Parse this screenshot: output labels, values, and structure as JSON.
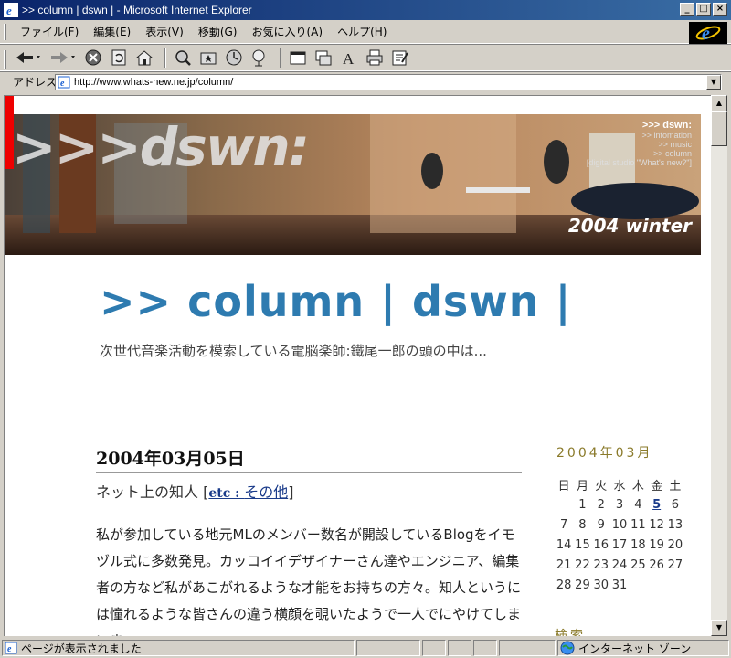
{
  "window": {
    "title": ">> column | dswn | - Microsoft Internet Explorer"
  },
  "menu": {
    "items": [
      "ファイル(F)",
      "編集(E)",
      "表示(V)",
      "移動(G)",
      "お気に入り(A)",
      "ヘルプ(H)"
    ]
  },
  "toolbar": {
    "buttons": [
      "back-icon",
      "forward-icon",
      "stop-icon",
      "refresh-icon",
      "home-icon",
      "search-icon",
      "favorites-icon",
      "history-icon",
      "channels-icon",
      "fullscreen-icon",
      "mail-icon",
      "font-icon",
      "print-icon",
      "edit-icon"
    ]
  },
  "address": {
    "label": "アドレス",
    "url": "http://www.whats-new.ne.jp/column/"
  },
  "banner": {
    "logo": ">>>dswn:",
    "nav_title": ">>> dswn:",
    "nav_items": [
      ">> infomation",
      ">> music",
      ">> column",
      "[digital studio \"What's new?\"]"
    ],
    "season": "2004 winter"
  },
  "page": {
    "title": ">> column | dswn |",
    "subtitle": "次世代音楽活動を模索している電脳楽師:鐵尾一郎の頭の中は..."
  },
  "entry": {
    "date": "2004年03月05日",
    "title": "ネット上の知人",
    "category_prefix": "etc : ",
    "category_name": "その他",
    "body": "私が参加している地元MLのメンバー数名が開設しているBlogをイモヅル式に多数発見。カッコイイデザイナーさん達やエンジニア、編集者の方など私があこがれるような才能をお持ちの方々。知人というには憧れるような皆さんの違う横顔を覗いたようで一人でにやけてしまいま"
  },
  "calendar": {
    "title": "2004年03月",
    "weekdays": [
      "日",
      "月",
      "火",
      "水",
      "木",
      "金",
      "土"
    ],
    "weeks": [
      [
        "",
        "1",
        "2",
        "3",
        "4",
        "5",
        "6"
      ],
      [
        "7",
        "8",
        "9",
        "10",
        "11",
        "12",
        "13"
      ],
      [
        "14",
        "15",
        "16",
        "17",
        "18",
        "19",
        "20"
      ],
      [
        "21",
        "22",
        "23",
        "24",
        "25",
        "26",
        "27"
      ],
      [
        "28",
        "29",
        "30",
        "31",
        "",
        "",
        ""
      ]
    ],
    "linked_day": "5"
  },
  "sidebar": {
    "search_title": "検索"
  },
  "status": {
    "text": "ページが表示されました",
    "zone": "インターネット ゾーン"
  },
  "colors": {
    "title_blue": "#2e7bb0",
    "sidebar_gold": "#8a7a2a",
    "link_blue": "#1a3b8a",
    "titlebar_start": "#0a246a"
  }
}
